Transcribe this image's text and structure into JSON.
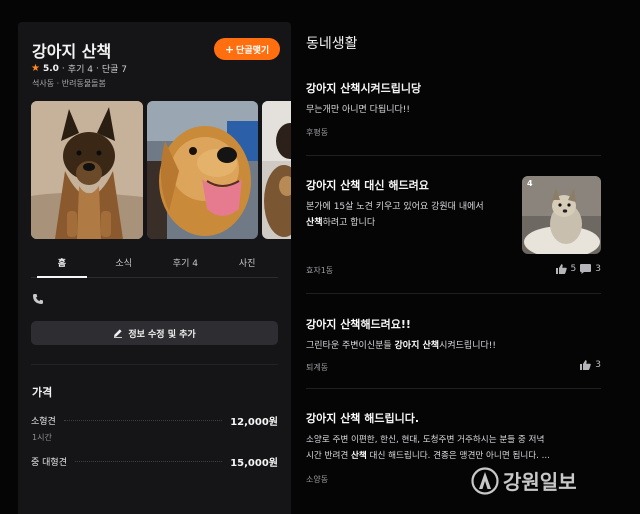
{
  "business": {
    "title": "강아지 산책",
    "follow_label": "단골맺기",
    "rating": "5.0",
    "reviews": "후기 4",
    "regulars": "단골 7",
    "separator": "·",
    "location": "석사동",
    "category": "반려동물돌봄",
    "meta_separator": " · "
  },
  "tabs": [
    {
      "label": "홈"
    },
    {
      "label": "소식"
    },
    {
      "label": "후기 4"
    },
    {
      "label": "사진"
    }
  ],
  "edit_label": "정보 수정 및 추가",
  "price": {
    "heading": "가격",
    "items": [
      {
        "name": "소형견",
        "amount": "12,000원",
        "sub": "1시간"
      },
      {
        "name": "중 대형견",
        "amount": "15,000원",
        "sub": ""
      }
    ]
  },
  "community": {
    "title": "동네생활",
    "posts": [
      {
        "title_highlight": "강아지 산책",
        "title_rest": "시켜드립니당",
        "body": "무는개만 아니면 다됩니다!!",
        "location": "후평동"
      },
      {
        "title_highlight": "강아지 산책",
        "title_rest": " 대신 해드려요",
        "body_line1": "본가에 15살 노견 키우고 있어요 강원대 내에서",
        "body_line2_bold": "산책",
        "body_line2_rest": "하려고 합니다",
        "location": "효자1동",
        "likes": "5",
        "comments": "3",
        "thumb_badge": "4"
      },
      {
        "title_highlight": "강아지 산책",
        "title_rest": "해드려요!!",
        "body_pre": "그린타운 주변이신분들 ",
        "body_bold1": "강아지 산책",
        "body_post": "시켜드립니다!!",
        "location": "퇴계동",
        "likes": "3"
      },
      {
        "title_highlight": "강아지 산책",
        "title_rest": " 해드립니다.",
        "body_line1": "소양로 주변 이편한, 한신, 현대, 도청주변 거주하시는 분들 중 저녁",
        "body_line2_pre": "시간 반려견 ",
        "body_line2_bold": "산책",
        "body_line2_rest": " 대신 해드립니다. 견종은 맹견만 아니면 됩니다. ...",
        "location": "소양동"
      }
    ]
  },
  "watermark": "강원일보",
  "colors": {
    "accent": "#ff6f0f",
    "panel": "#151517",
    "background": "#050505"
  },
  "icons": [
    "plus-icon",
    "star-icon",
    "phone-icon",
    "pencil-icon",
    "thumbs-up-icon",
    "comment-icon",
    "watermark-logo-icon"
  ]
}
